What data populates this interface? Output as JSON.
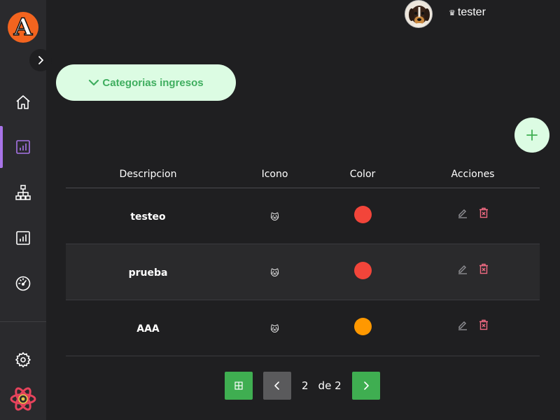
{
  "header": {
    "username": "tester",
    "crown_glyph": "♛"
  },
  "sidebar": {
    "logo_letter": "A",
    "items": [
      {
        "name": "home",
        "icon": "home-icon",
        "active": false
      },
      {
        "name": "chart",
        "icon": "bar-chart-icon",
        "active": true
      },
      {
        "name": "hierarchy",
        "icon": "sitemap-icon",
        "active": false
      },
      {
        "name": "report",
        "icon": "report-chart-icon",
        "active": false
      },
      {
        "name": "speedometer",
        "icon": "speedometer-icon",
        "active": false
      }
    ],
    "settings_icon": "gear-icon",
    "bottom_icon": "react-atom-icon"
  },
  "category_button": {
    "label": "Categorias ingresos",
    "icon": "chevron-down-icon"
  },
  "add_button": {
    "icon": "plus-icon"
  },
  "table": {
    "headers": {
      "description": "Descripcion",
      "icon": "Icono",
      "color": "Color",
      "actions": "Acciones"
    },
    "rows": [
      {
        "description": "testeo",
        "icon": "🐱",
        "color": "#f2453a"
      },
      {
        "description": "prueba",
        "icon": "🐱",
        "color": "#f2453a"
      },
      {
        "description": "AAA",
        "icon": "🐱",
        "color": "#ff9800"
      }
    ],
    "action_icons": {
      "edit": "edit-icon",
      "delete": "delete-icon"
    }
  },
  "pagination": {
    "current_page": "2",
    "total_text": "de 2"
  },
  "colors": {
    "accent_green": "#3fae51",
    "mint": "#dcfce3",
    "active_purple": "#a874e8",
    "delete_pink": "#f06a82",
    "logo_orange": "#f2641f"
  }
}
